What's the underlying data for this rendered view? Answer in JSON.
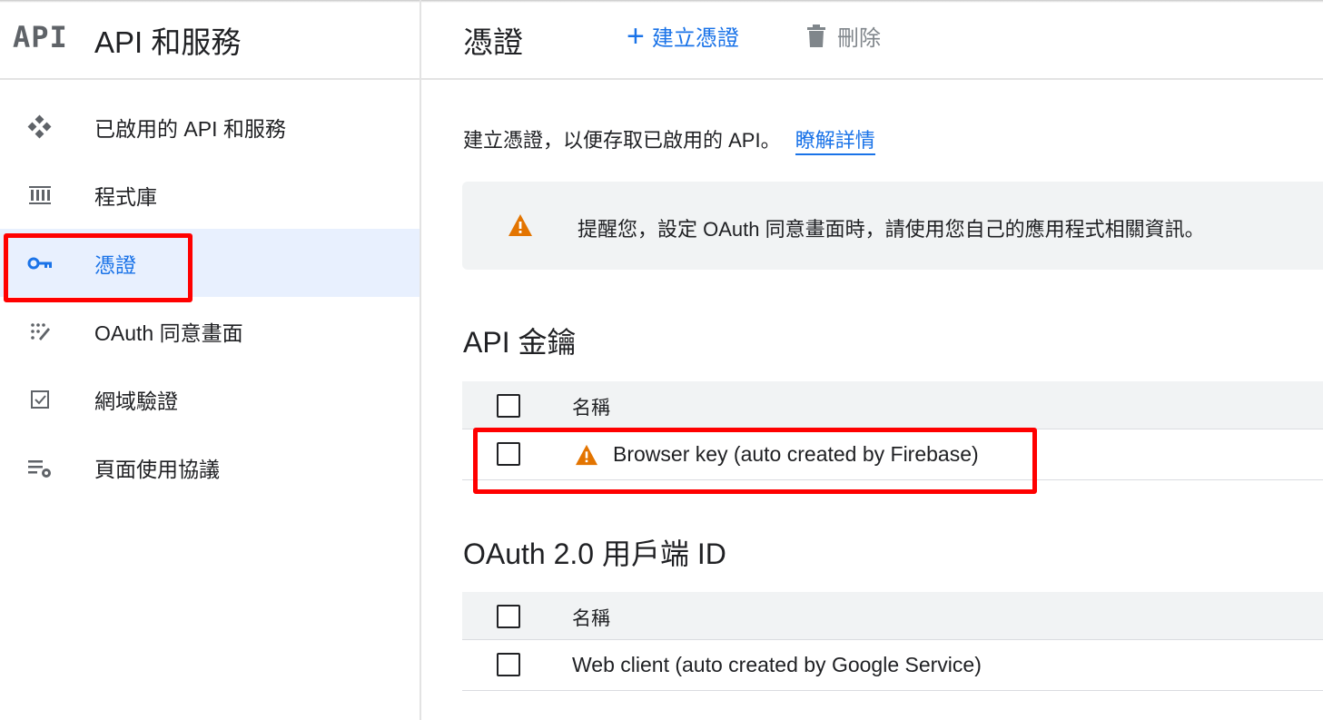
{
  "sidebar": {
    "logo": "API",
    "title": "API 和服務",
    "items": [
      {
        "label": "已啟用的 API 和服務",
        "icon": "api-diamond-icon"
      },
      {
        "label": "程式庫",
        "icon": "library-icon"
      },
      {
        "label": "憑證",
        "icon": "key-icon",
        "active": true
      },
      {
        "label": "OAuth 同意畫面",
        "icon": "oauth-dots-icon"
      },
      {
        "label": "網域驗證",
        "icon": "checkbox-verify-icon"
      },
      {
        "label": "頁面使用協議",
        "icon": "settings-list-icon"
      }
    ]
  },
  "header": {
    "title": "憑證",
    "create_label": "建立憑證",
    "delete_label": "刪除"
  },
  "intro": {
    "text": "建立憑證，以便存取已啟用的 API。",
    "link": "瞭解詳情"
  },
  "notice": {
    "text": "提醒您，設定 OAuth 同意畫面時，請使用您自己的應用程式相關資訊。"
  },
  "api_keys": {
    "title": "API 金鑰",
    "column_name": "名稱",
    "rows": [
      {
        "name": "Browser key (auto created by Firebase)",
        "warning": true
      }
    ]
  },
  "oauth_clients": {
    "title": "OAuth 2.0 用戶端 ID",
    "column_name": "名稱",
    "rows": [
      {
        "name": "Web client (auto created by Google Service)"
      }
    ]
  },
  "colors": {
    "accent": "#1a73e8",
    "warning": "#e37400",
    "highlight": "#ff0000"
  }
}
